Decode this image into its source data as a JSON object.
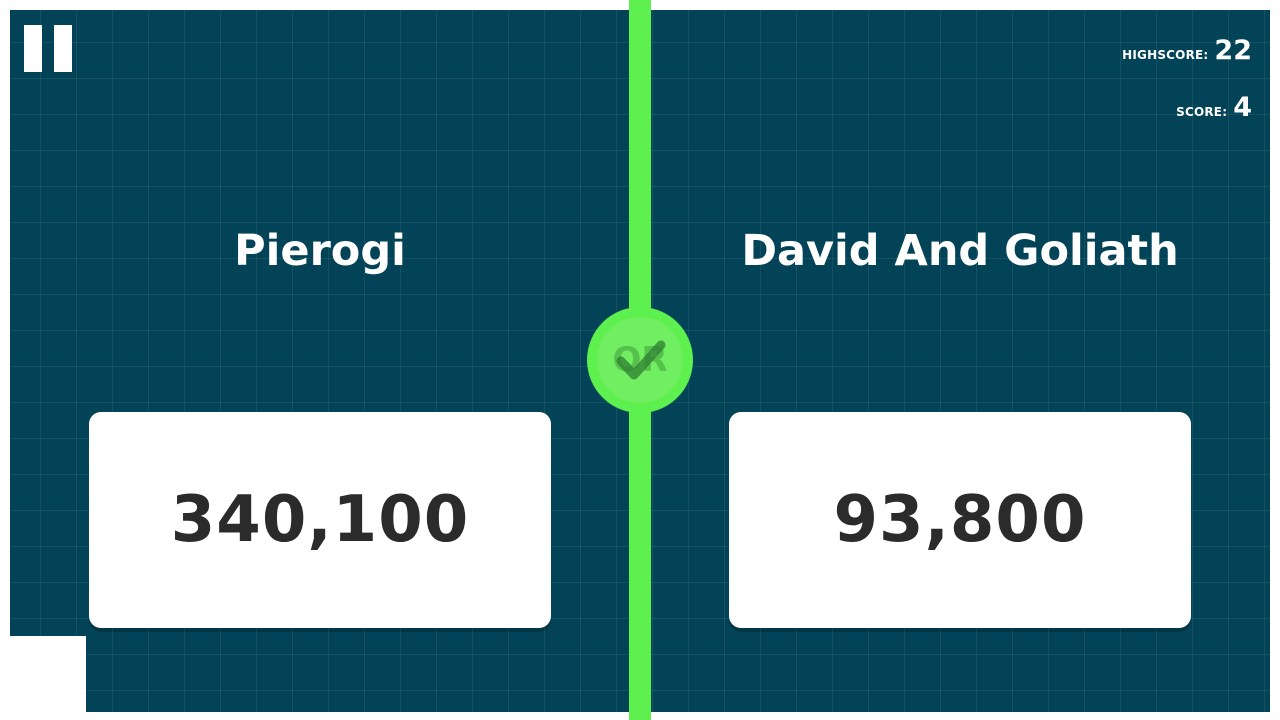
{
  "hud": {
    "highscore_label": "HIGHSCORE:",
    "highscore_value": "22",
    "score_label": "SCORE:",
    "score_value": "4"
  },
  "left": {
    "name": "Pierogi",
    "value": "340,100"
  },
  "right": {
    "name": "David And Goliath",
    "value": "93,800"
  },
  "center_badge": {
    "text": "OR",
    "icon": "checkmark-icon",
    "state": "correct"
  },
  "colors": {
    "background": "#034357",
    "accent_green": "#5ef04f",
    "card": "#ffffff",
    "value_text": "#2b2b2b"
  }
}
